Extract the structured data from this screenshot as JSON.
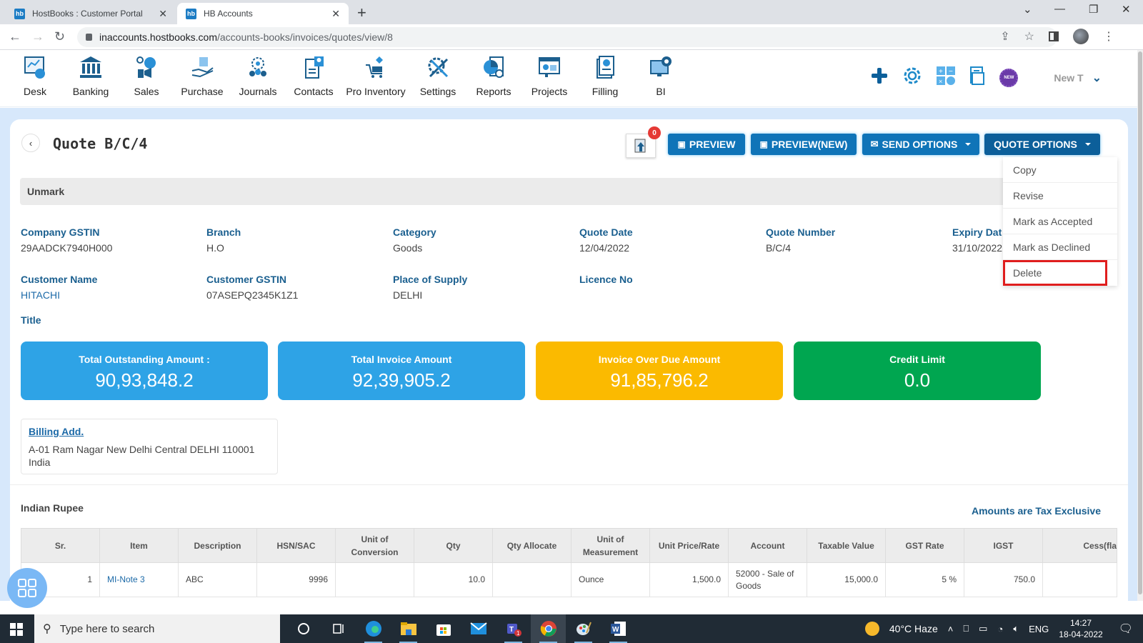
{
  "browser": {
    "tabs": [
      {
        "label": "HostBooks : Customer Portal",
        "favicon": "hb",
        "active": false
      },
      {
        "label": "HB Accounts",
        "favicon": "hb",
        "active": true
      }
    ],
    "url_host": "inaccounts.hostbooks.com",
    "url_path": "/accounts-books/invoices/quotes/view/8"
  },
  "app": {
    "modules": [
      {
        "label": "Desk",
        "icon": "desk-icon"
      },
      {
        "label": "Banking",
        "icon": "bank-icon"
      },
      {
        "label": "Sales",
        "icon": "sales-icon"
      },
      {
        "label": "Purchase",
        "icon": "purchase-icon"
      },
      {
        "label": "Journals",
        "icon": "journals-icon"
      },
      {
        "label": "Contacts",
        "icon": "contacts-icon"
      },
      {
        "label": "Pro Inventory",
        "icon": "inventory-icon"
      },
      {
        "label": "Settings",
        "icon": "settings-icon"
      },
      {
        "label": "Reports",
        "icon": "reports-icon"
      },
      {
        "label": "Projects",
        "icon": "projects-icon"
      },
      {
        "label": "Filling",
        "icon": "filling-icon"
      },
      {
        "label": "BI",
        "icon": "bi-icon"
      }
    ],
    "header_right": {
      "new_badge": "NEW",
      "company_label": "New T"
    }
  },
  "page": {
    "title": "Quote B/C/4",
    "upload_badge_count": "0",
    "buttons": {
      "preview": "PREVIEW",
      "preview_new": "PREVIEW(NEW)",
      "send_options": "SEND OPTIONS",
      "quote_options": "QUOTE OPTIONS"
    },
    "quote_options_menu": [
      "Copy",
      "Revise",
      "Mark as Accepted",
      "Mark as Declined",
      "Delete"
    ],
    "highlighted_menu_item": "Delete",
    "status_bar": "Unmark",
    "fields": {
      "company_gstin": {
        "label": "Company GSTIN",
        "value": "29AADCK7940H000"
      },
      "branch": {
        "label": "Branch",
        "value": "H.O"
      },
      "category": {
        "label": "Category",
        "value": "Goods"
      },
      "quote_date": {
        "label": "Quote Date",
        "value": "12/04/2022"
      },
      "quote_number": {
        "label": "Quote Number",
        "value": "B/C/4"
      },
      "expiry_date": {
        "label": "Expiry Dat",
        "value": "31/10/2022"
      },
      "customer_name": {
        "label": "Customer Name",
        "value": "HITACHI"
      },
      "customer_gstin": {
        "label": "Customer GSTIN",
        "value": "07ASEPQ2345K1Z1"
      },
      "place_of_supply": {
        "label": "Place of Supply",
        "value": "DELHI"
      },
      "licence_no": {
        "label": "Licence No",
        "value": ""
      }
    },
    "title_label": "Title",
    "stats": [
      {
        "label": "Total Outstanding Amount :",
        "value": "90,93,848.2",
        "color": "#2ea3e6"
      },
      {
        "label": "Total Invoice Amount",
        "value": "92,39,905.2",
        "color": "#2ea3e6"
      },
      {
        "label": "Invoice Over Due Amount",
        "value": "91,85,796.2",
        "color": "#fbba00"
      },
      {
        "label": "Credit Limit",
        "value": "0.0",
        "color": "#00a650"
      }
    ],
    "billing": {
      "label": "Billing Add.",
      "address": "A-01 Ram Nagar New Delhi Central DELHI 110001",
      "country": "India"
    },
    "currency": "Indian Rupee",
    "tax_mode": "Amounts are Tax Exclusive",
    "table": {
      "columns": [
        "Sr.",
        "Item",
        "Description",
        "HSN/SAC",
        "Unit of Conversion",
        "Qty",
        "Qty Allocate",
        "Unit of Measurement",
        "Unit Price/Rate",
        "Account",
        "Taxable Value",
        "GST Rate",
        "IGST",
        "Cess(fla"
      ],
      "rows": [
        [
          "1",
          "MI-Note 3",
          "ABC",
          "9996",
          "",
          "10.0",
          "",
          "Ounce",
          "1,500.0",
          "52000 - Sale of Goods",
          "15,000.0",
          "5 %",
          "750.0",
          ""
        ]
      ]
    }
  },
  "taskbar": {
    "search_placeholder": "Type here to search",
    "weather": "40°C  Haze",
    "lang": "ENG",
    "time": "14:27",
    "date": "18-04-2022",
    "teams_badge": "1"
  },
  "colors": {
    "primary": "#0f74b8",
    "label_blue": "#1a5f8f",
    "highlight_red": "#e01e1e"
  }
}
